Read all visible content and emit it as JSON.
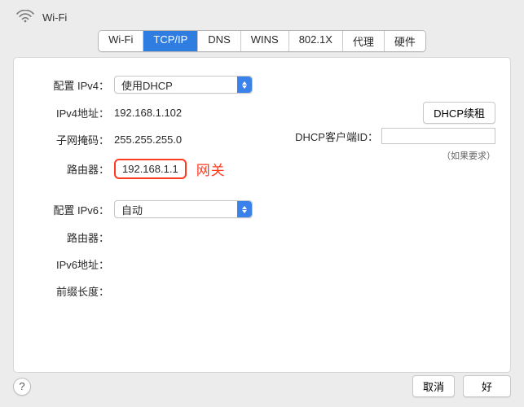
{
  "header": {
    "title": "Wi-Fi"
  },
  "tabs": {
    "items": [
      {
        "label": "Wi-Fi"
      },
      {
        "label": "TCP/IP"
      },
      {
        "label": "DNS"
      },
      {
        "label": "WINS"
      },
      {
        "label": "802.1X"
      },
      {
        "label": "代理"
      },
      {
        "label": "硬件"
      }
    ],
    "selected_index": 1
  },
  "ipv4": {
    "configure_label": "配置 IPv4",
    "configure_value": "使用DHCP",
    "address_label": "IPv4地址",
    "address_value": "192.168.1.102",
    "subnet_label": "子网掩码",
    "subnet_value": "255.255.255.0",
    "router_label": "路由器",
    "router_value": "192.168.1.1",
    "dhcp_renew_label": "DHCP续租",
    "dhcp_client_label": "DHCP客户端ID",
    "dhcp_client_value": "",
    "dhcp_hint": "（如果要求）"
  },
  "annotation": {
    "gateway": "网关"
  },
  "ipv6": {
    "configure_label": "配置 IPv6",
    "configure_value": "自动",
    "router_label": "路由器",
    "router_value": "",
    "address_label": "IPv6地址",
    "address_value": "",
    "prefix_label": "前缀长度",
    "prefix_value": ""
  },
  "footer": {
    "help": "?",
    "cancel": "取消",
    "ok": "好"
  }
}
